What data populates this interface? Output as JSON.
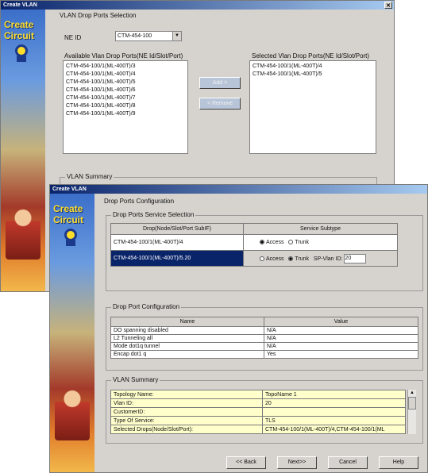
{
  "back_window": {
    "title": "Create VLAN",
    "section_title": "VLAN Drop Ports Selection",
    "ne_id_label": "NE ID",
    "ne_id_value": "CTM-454-100",
    "available_label": "Available Vlan Drop Ports(NE Id/Slot/Port)",
    "available_items": [
      "CTM-454-100/1(ML-400T)/3",
      "CTM-454-100/1(ML-400T)/4",
      "CTM-454-100/1(ML-400T)/5",
      "CTM-454-100/1(ML-400T)/6",
      "CTM-454-100/1(ML-400T)/7",
      "CTM-454-100/1(ML-400T)/8",
      "CTM-454-100/1(ML-400T)/9"
    ],
    "selected_label": "Selected Vlan Drop Ports(NE Id/Slot/Port)",
    "selected_items": [
      "CTM-454-100/1(ML-400T)/4",
      "CTM-454-100/1(ML-400T)/5"
    ],
    "add_button": "Add >",
    "remove_button": "< Remove",
    "summary_label": "VLAN Summary",
    "logo_line1": "Create",
    "logo_line2": "Circuit"
  },
  "front_window": {
    "title": "Create VLAN",
    "logo_line1": "Create",
    "logo_line2": "Circuit",
    "section_title": "Drop Ports Configuration",
    "service_group_title": "Drop Ports Service Selection",
    "service_headers": [
      "Drop(Node/Slot/Port SubIF)",
      "Service Subtype"
    ],
    "service_rows": [
      {
        "drop": "CTM-454-100/1(ML-400T)/4",
        "access": "Access",
        "trunk": "Trunk"
      },
      {
        "drop": "CTM-454-100/1(ML-400T)/5.20",
        "access": "Access",
        "trunk": "Trunk",
        "sp_label": "SP-Vlan ID:",
        "sp_value": "20"
      }
    ],
    "config_group_title": "Drop Port Configuration",
    "config_headers": [
      "Name",
      "Value"
    ],
    "config_rows": [
      {
        "name": "DO spanning disabled",
        "value": "N/A"
      },
      {
        "name": "L2 Tunneling all",
        "value": "N/A"
      },
      {
        "name": "Mode dot1q tunnel",
        "value": "N/A"
      },
      {
        "name": "Encap dot1 q",
        "value": "Yes"
      }
    ],
    "summary_group_title": "VLAN Summary",
    "summary_rows": [
      {
        "name": "Topology Name:",
        "value": "TopoName 1"
      },
      {
        "name": "Vlan ID:",
        "value": "20"
      },
      {
        "name": "CustomerID:",
        "value": ""
      },
      {
        "name": "Type Of Service:",
        "value": "TLS"
      },
      {
        "name": "Selected Drops(Node/Slot/Port):",
        "value": "CTM-454-100/1(ML-400T)/4,CTM-454-100/1(ML"
      }
    ],
    "buttons": {
      "back": "<< Back",
      "next": "Next>>",
      "cancel": "Cancel",
      "help": "Help"
    }
  },
  "colors": {
    "title_start": "#0a246a",
    "title_end": "#a6caf0",
    "summary_bg": "#ffffcc",
    "selected_row": "#0a246a"
  }
}
